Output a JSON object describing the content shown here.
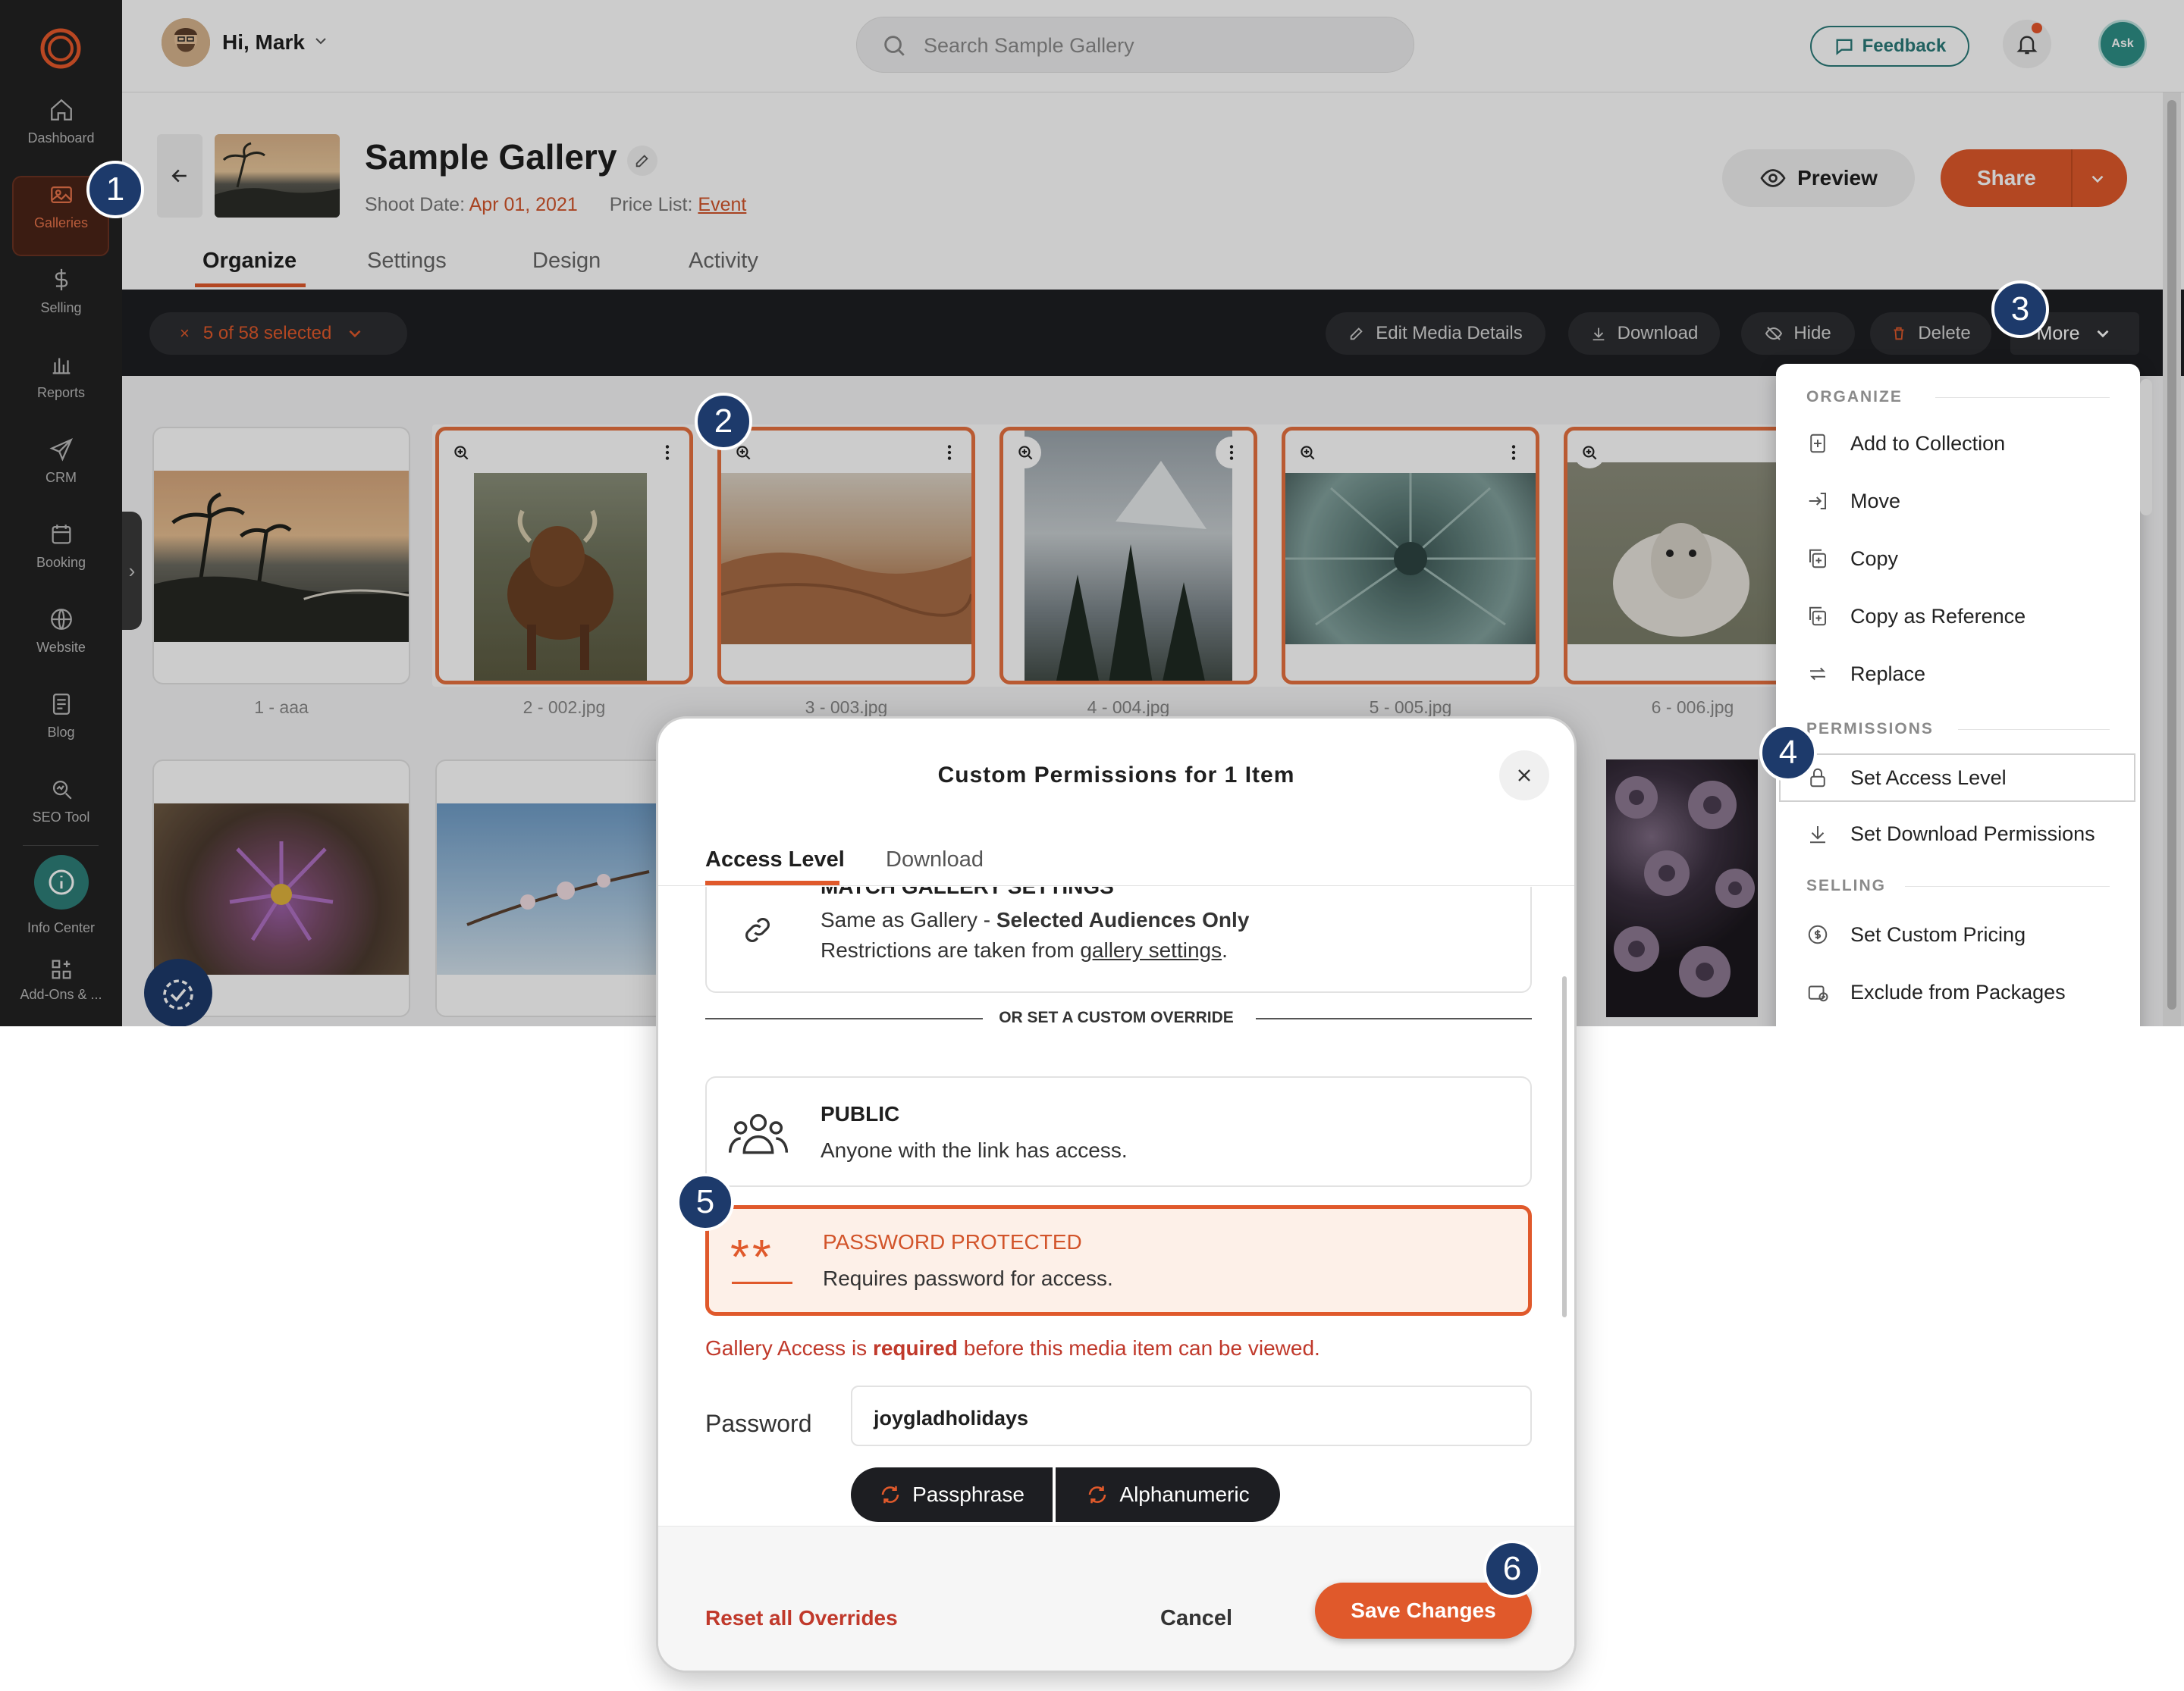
{
  "sidebar": {
    "items": [
      {
        "label": "Dashboard",
        "icon": "home-icon"
      },
      {
        "label": "Galleries",
        "icon": "gallery-icon"
      },
      {
        "label": "Selling",
        "icon": "dollar-icon"
      },
      {
        "label": "Reports",
        "icon": "bar-chart-icon"
      },
      {
        "label": "CRM",
        "icon": "paper-plane-icon"
      },
      {
        "label": "Booking",
        "icon": "calendar-icon"
      },
      {
        "label": "Website",
        "icon": "globe-icon"
      },
      {
        "label": "Blog",
        "icon": "document-icon"
      },
      {
        "label": "SEO Tool",
        "icon": "seo-icon"
      },
      {
        "label": "Info Center",
        "icon": "info-icon"
      },
      {
        "label": "Add-Ons & ...",
        "icon": "add-ons-icon"
      }
    ]
  },
  "topbar": {
    "greeting": "Hi, Mark",
    "search_placeholder": "Search Sample Gallery",
    "feedback_label": "Feedback",
    "ask_label": "Ask"
  },
  "header": {
    "title": "Sample Gallery",
    "shoot_date_label": "Shoot Date:",
    "shoot_date": "Apr 01, 2021",
    "price_list_label": "Price List:",
    "price_list": "Event",
    "preview_label": "Preview",
    "share_label": "Share",
    "tabs": [
      "Organize",
      "Settings",
      "Design",
      "Activity"
    ],
    "active_tab": "Organize"
  },
  "toolbar": {
    "selection": "5 of 58 selected",
    "edit_label": "Edit Media Details",
    "download_label": "Download",
    "hide_label": "Hide",
    "delete_label": "Delete",
    "more_label": "More"
  },
  "media": {
    "row1": [
      {
        "caption": "1 - aaa",
        "selected": false
      },
      {
        "caption": "2 - 002.jpg",
        "selected": true
      },
      {
        "caption": "3 - 003.jpg",
        "selected": true
      },
      {
        "caption": "4 - 004.jpg",
        "selected": true
      },
      {
        "caption": "5 - 005.jpg",
        "selected": true
      },
      {
        "caption": "6 - 006.jpg",
        "selected": true
      }
    ]
  },
  "more_menu": {
    "organize_header": "ORGANIZE",
    "organize_items": [
      "Add to Collection",
      "Move",
      "Copy",
      "Copy as Reference",
      "Replace"
    ],
    "permissions_header": "PERMISSIONS",
    "permissions_items": [
      "Set Access Level",
      "Set Download Permissions"
    ],
    "selling_header": "SELLING",
    "selling_items": [
      "Set Custom Pricing",
      "Exclude from Packages"
    ]
  },
  "modal": {
    "title": "Custom Permissions for 1 Item",
    "tabs": [
      "Access Level",
      "Download"
    ],
    "match": {
      "heading": "MATCH GALLERY SETTINGS",
      "line1_prefix": "Same as Gallery - ",
      "line1_bold": "Selected Audiences Only",
      "line2_prefix": "Restrictions are taken from ",
      "line2_link": "gallery settings",
      "line2_suffix": "."
    },
    "divider_text": "OR SET A CUSTOM OVERRIDE",
    "public": {
      "heading": "PUBLIC",
      "description": "Anyone with the link has access."
    },
    "password_protected": {
      "heading": "PASSWORD PROTECTED",
      "description": "Requires password for access."
    },
    "warning_prefix": "Gallery Access is ",
    "warning_bold": "required",
    "warning_suffix": " before this media item can be viewed.",
    "password_label": "Password",
    "password_value": "joygladholidays",
    "passphrase_label": "Passphrase",
    "alphanumeric_label": "Alphanumeric",
    "reset_label": "Reset all Overrides",
    "cancel_label": "Cancel",
    "save_label": "Save Changes"
  },
  "step_badges": [
    "1",
    "2",
    "3",
    "4",
    "5",
    "6"
  ],
  "colors": {
    "accent": "#e0592b",
    "sidebar": "#222222",
    "toolbar": "#1d1e22",
    "badge": "#1d3a6b",
    "teal": "#2d7f79"
  }
}
